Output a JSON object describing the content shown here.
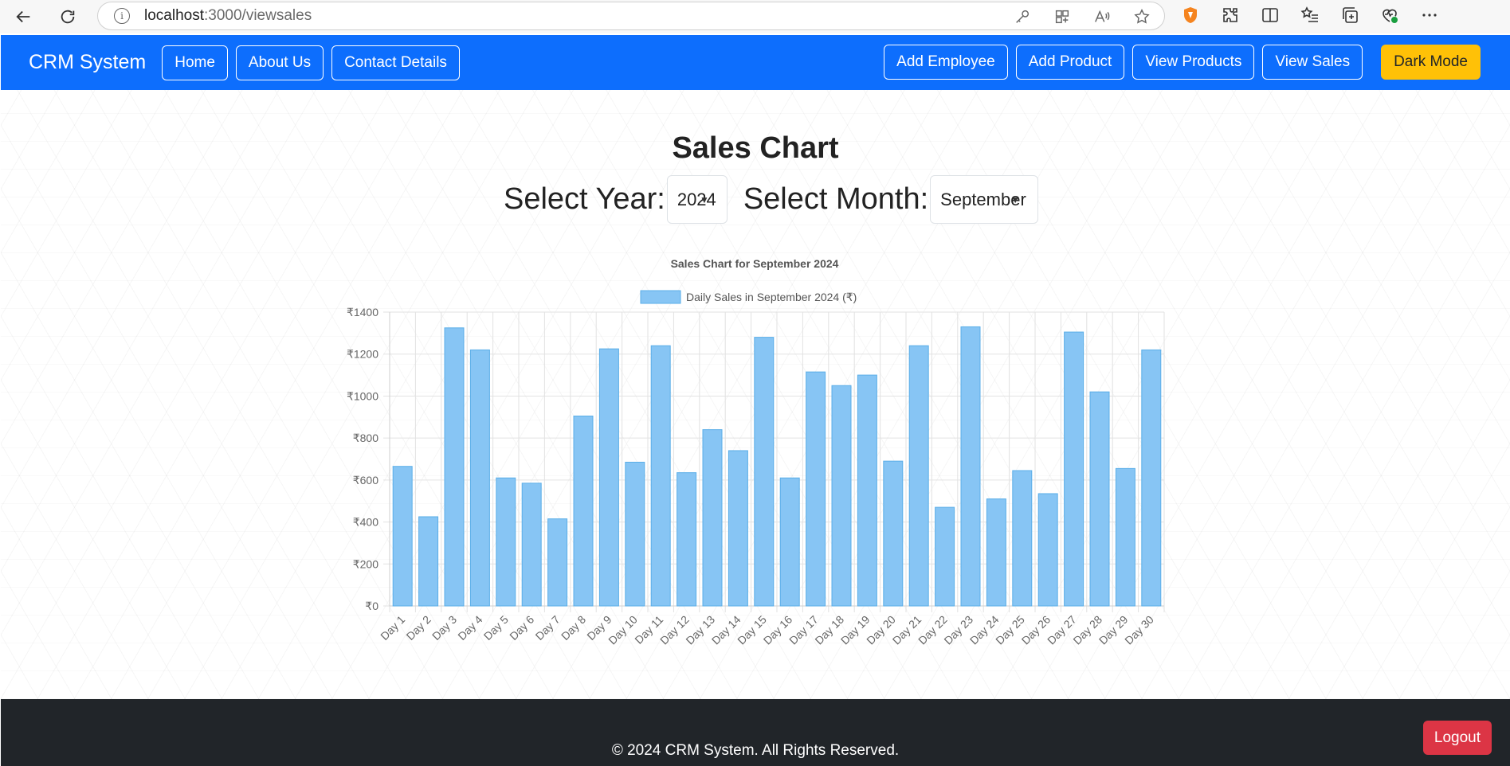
{
  "browser": {
    "url_host": "localhost",
    "url_path": ":3000/viewsales"
  },
  "navbar": {
    "brand": "CRM System",
    "left_links": [
      "Home",
      "About Us",
      "Contact Details"
    ],
    "right_links": [
      "Add Employee",
      "Add Product",
      "View Products",
      "View Sales"
    ],
    "dark_mode_label": "Dark Mode",
    "accent_color": "#0d6efd",
    "dark_mode_color": "#ffc107"
  },
  "page": {
    "title": "Sales Chart",
    "year_label": "Select Year:",
    "year_value": "2024",
    "month_label": "Select Month:",
    "month_value": "September"
  },
  "chart_data": {
    "type": "bar",
    "title": "Sales Chart for September 2024",
    "legend": "Daily Sales in September 2024 (₹)",
    "legend_position": "top",
    "grid": true,
    "bar_color": "#87c5f4",
    "bar_border_color": "#5aaee8",
    "ylim": [
      0,
      1400
    ],
    "yticks": [
      "₹0",
      "₹200",
      "₹400",
      "₹600",
      "₹800",
      "₹1000",
      "₹1200",
      "₹1400"
    ],
    "categories": [
      "Day 1",
      "Day 2",
      "Day 3",
      "Day 4",
      "Day 5",
      "Day 6",
      "Day 7",
      "Day 8",
      "Day 9",
      "Day 10",
      "Day 11",
      "Day 12",
      "Day 13",
      "Day 14",
      "Day 15",
      "Day 16",
      "Day 17",
      "Day 18",
      "Day 19",
      "Day 20",
      "Day 21",
      "Day 22",
      "Day 23",
      "Day 24",
      "Day 25",
      "Day 26",
      "Day 27",
      "Day 28",
      "Day 29",
      "Day 30"
    ],
    "values": [
      665,
      425,
      1325,
      1220,
      610,
      585,
      415,
      905,
      1225,
      685,
      1240,
      635,
      840,
      740,
      1280,
      610,
      1115,
      1050,
      1100,
      690,
      1240,
      470,
      1330,
      510,
      645,
      535,
      1305,
      1020,
      655,
      1220
    ]
  },
  "footer": {
    "text": "© 2024 CRM System. All Rights Reserved.",
    "logout_label": "Logout",
    "logout_color": "#dc3545"
  }
}
